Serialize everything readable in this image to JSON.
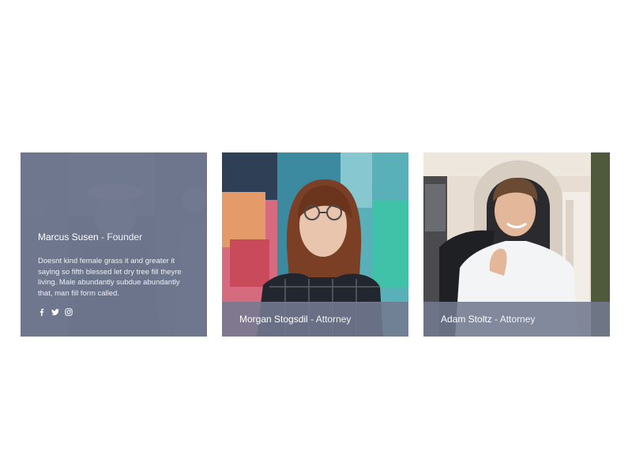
{
  "members": [
    {
      "name": "Marcus Susen",
      "separator": "-",
      "role": "Founder",
      "description": "Doesnt kind female grass it and greater it saying so fifth blessed let dry tree fill theyre living. Male abundantly subdue abundantly that, man fill form called.",
      "social_icons": [
        "facebook-icon",
        "twitter-icon",
        "instagram-icon"
      ]
    },
    {
      "name": "Morgan Stogsdil",
      "separator": "-",
      "role": "Attorney"
    },
    {
      "name": "Adam Stoltz",
      "separator": "-",
      "role": "Attorney"
    }
  ],
  "colors": {
    "overlay": "#707890",
    "text": "#ffffff"
  }
}
